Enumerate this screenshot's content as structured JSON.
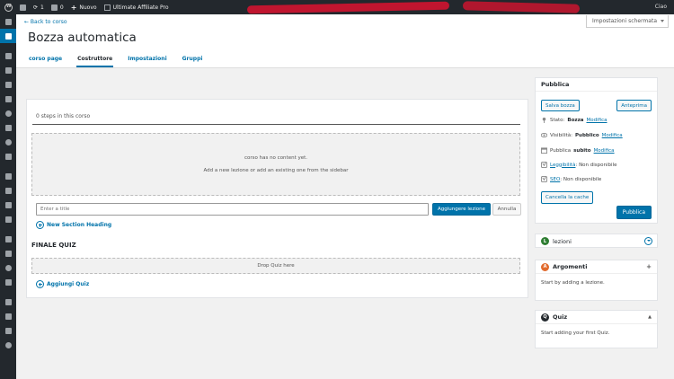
{
  "admin_bar": {
    "updates_count": "1",
    "comments_count": "0",
    "new_label": "Nuovo",
    "plugin_label": "Ultimate Affiliate Pro",
    "user_partial": "Ciao"
  },
  "header": {
    "back_link": "← Back to corso",
    "title": "Bozza automatica",
    "screen_options": "Impostazioni schermata",
    "tabs": [
      {
        "label": "corso page",
        "active": false
      },
      {
        "label": "Costruttore",
        "active": true
      },
      {
        "label": "Impostazioni",
        "active": false
      },
      {
        "label": "Gruppi",
        "active": false
      }
    ]
  },
  "builder": {
    "steps_count": "0 steps in this corso",
    "empty_line1": "corso has no content yet.",
    "empty_line2": "Add a new lezione or add an existing one from the sidebar",
    "title_placeholder": "Enter a title",
    "add_lesson_button": "Aggiungere lezione",
    "cancel_button": "Annulla",
    "new_section": "New Section Heading",
    "final_quiz_title": "FINALE QUIZ",
    "quiz_drop": "Drop Quiz here",
    "add_quiz": "Aggiungi Quiz"
  },
  "publish": {
    "title": "Pubblica",
    "save_draft": "Salva bozza",
    "preview": "Anteprima",
    "status_label": "Stato:",
    "status_value": "Bozza",
    "visibility_label": "Visibilità:",
    "visibility_value": "Pubblico",
    "publish_label": "Pubblica",
    "publish_value": "subito",
    "readability_label": "Leggibilità",
    "readability_value": ": Non disponibile",
    "seo_label": "SEO",
    "seo_value": ": Non disponibile",
    "edit_link": "Modifica",
    "clear_cache": "Cancella la cache",
    "publish_button": "Pubblica"
  },
  "lessons_box": {
    "badge": "L",
    "title": "lezioni"
  },
  "topics_box": {
    "badge": "A",
    "title": "Argomenti",
    "toggle": "+",
    "empty": "Start by adding a lezione."
  },
  "quiz_box": {
    "badge": "Q",
    "title": "Quiz",
    "toggle": "▲",
    "empty": "Start adding your first Quiz."
  },
  "colors": {
    "accent": "#0073aa",
    "admin_bar": "#23282d",
    "redaction": "#c0152f"
  }
}
